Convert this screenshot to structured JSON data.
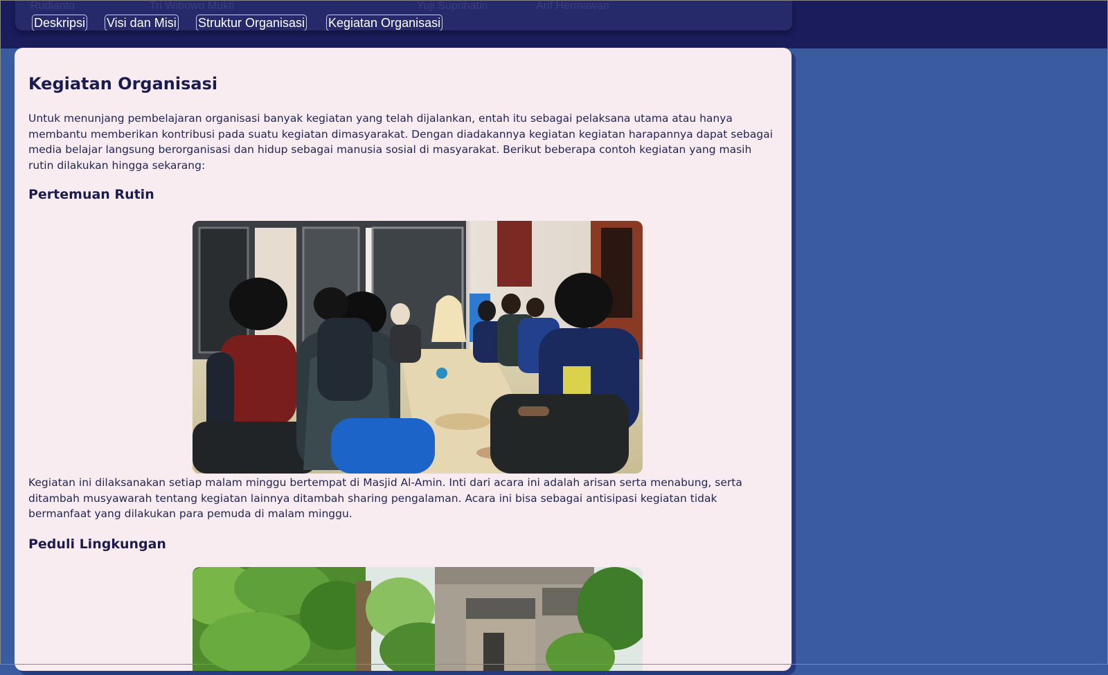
{
  "nav": {
    "ghost_names": [
      "Rudianto",
      "Tri Wibowo Mukti",
      "Yuji Suprihatin",
      "Arif Hermawan"
    ],
    "tabs": [
      {
        "label": "Deskripsi"
      },
      {
        "label": "Visi dan Misi"
      },
      {
        "label": "Struktur Organisasi"
      },
      {
        "label": "Kegiatan Organisasi"
      }
    ]
  },
  "main": {
    "title": "Kegiatan Organisasi",
    "intro": "Untuk menunjang pembelajaran organisasi banyak kegiatan yang telah dijalankan, entah itu sebagai pelaksana utama atau hanya membantu memberikan kontribusi pada suatu kegiatan dimasyarakat. Dengan diadakannya kegiatan kegiatan harapannya dapat sebagai media belajar langsung berorganisasi dan hidup sebagai manusia sosial di masyarakat. Berikut beberapa contoh kegiatan yang masih rutin dilakukan hingga sekarang:",
    "sections": [
      {
        "title": "Pertemuan Rutin",
        "description": "Kegiatan ini dilaksanakan setiap malam minggu bertempat di Masjid Al-Amin. Inti dari acara ini adalah arisan serta menabung, serta ditambah musyawarah tentang kegiatan lainnya ditambah sharing pengalaman. Acara ini bisa sebagai antisipasi kegiatan tidak bermanfaat yang dilakukan para pemuda di malam minggu."
      },
      {
        "title": "Peduli Lingkungan"
      }
    ]
  },
  "colors": {
    "page_bg": "#3a5ba0",
    "topbar": "#1a1c5c",
    "card_bg": "#f9ecf1",
    "text_dark": "#1a1c50"
  }
}
